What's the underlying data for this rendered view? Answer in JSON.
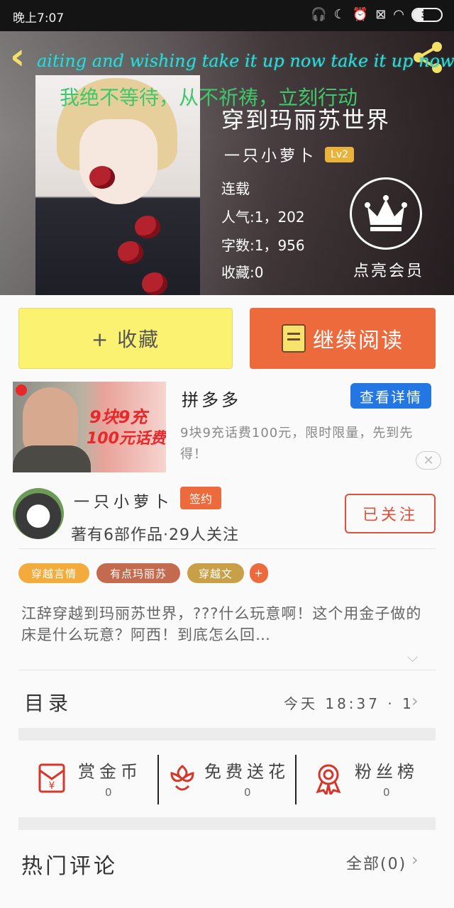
{
  "status_bar": {
    "time": "晚上7:07",
    "battery": "37",
    "battery_level": 0.37
  },
  "header": {
    "marquee_en": "aiting and wishing take it up now take it up now",
    "marquee_cn": "我绝不等待，从不祈祷，立刻行动"
  },
  "book": {
    "title": "穿到玛丽苏世界",
    "author": "一只小萝卜",
    "author_level": "Lv2",
    "status": "连载",
    "popularity": "人气:1，202",
    "word_count": "字数:1，956",
    "collections": "收藏:0",
    "vip_label": "点亮会员"
  },
  "actions": {
    "collect_label": "+ 收藏",
    "read_label": "继续阅读"
  },
  "ad": {
    "promo_line1": "9块9充",
    "promo_line2": "100元话费",
    "title": "拼多多",
    "detail_button": "查看详情",
    "description": "9块9充话费100元，限时限量，先到先得！",
    "close": "✕"
  },
  "author_card": {
    "name": "一只小萝卜",
    "badge": "签约",
    "stats": "著有6部作品·29人关注",
    "follow_button": "已关注"
  },
  "tags": [
    {
      "label": "穿越言情",
      "color": "#f3ac3b"
    },
    {
      "label": "有点玛丽苏",
      "color": "#c46b4f"
    },
    {
      "label": "穿越文",
      "color": "#c9a048"
    },
    {
      "label": "+",
      "color": "#ec6a3c"
    }
  ],
  "synopsis": "江辞穿越到玛丽苏世界，???什么玩意啊！这个用金子做的床是什么玩意？阿西！到底怎么回…",
  "toc": {
    "label": "目录",
    "update": "今天 18:37 · 1"
  },
  "rewards": [
    {
      "label": "赏金币",
      "count": "0",
      "icon": "red-envelope-yen-icon"
    },
    {
      "label": "免费送花",
      "count": "0",
      "icon": "flower-icon"
    },
    {
      "label": "粉丝榜",
      "count": "0",
      "icon": "rank-medal-icon"
    }
  ],
  "comments": {
    "label": "热门评论",
    "all_label": "全部(0)"
  },
  "colors": {
    "accent": "#ec6a3c",
    "collect_bg": "#fbf272",
    "detail_blue": "#2477e3"
  }
}
